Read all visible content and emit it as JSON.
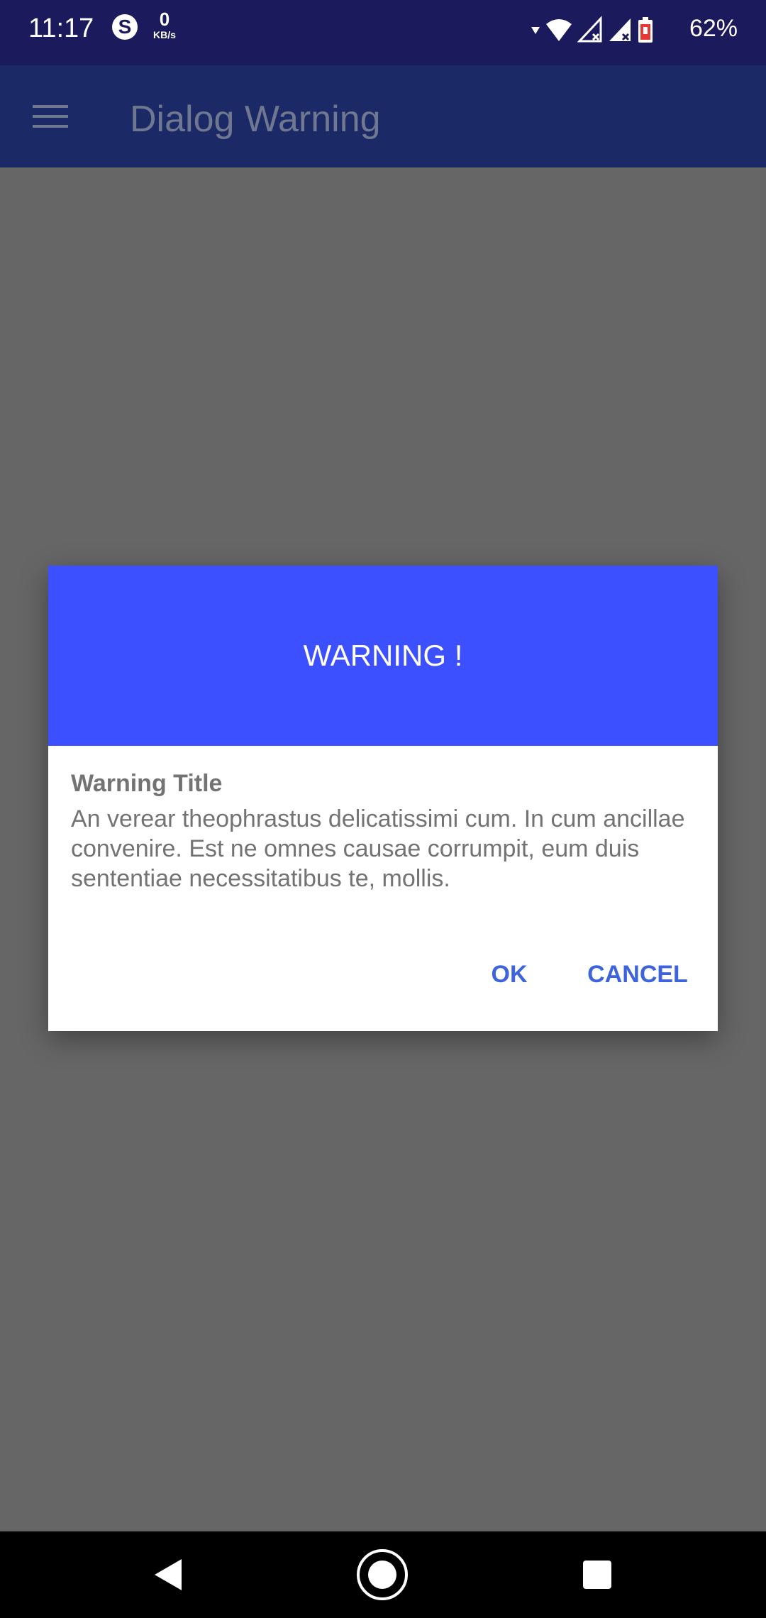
{
  "status_bar": {
    "time": "11:17",
    "net_speed_value": "0",
    "net_speed_unit": "KB/s",
    "battery_percent": "62%",
    "icons": [
      "skype-icon",
      "data-activity-icon",
      "wifi-icon",
      "signal-icon",
      "signal-icon",
      "battery-icon"
    ]
  },
  "app_bar": {
    "title": "Dialog Warning",
    "menu_icon": "menu-icon"
  },
  "dialog": {
    "header": "WARNING !",
    "title": "Warning Title",
    "message": "An verear theophrastus delicatissimi cum. In cum ancillae convenire. Est ne omnes causae corrumpit, eum duis sententiae necessitatibus te, mollis.",
    "ok_label": "OK",
    "cancel_label": "CANCEL"
  },
  "nav_bar": {
    "icons": [
      "back-icon",
      "home-icon",
      "recents-icon"
    ]
  },
  "colors": {
    "status_bar": "#1a1a5c",
    "app_bar": "#1b2a66",
    "dialog_header": "#3d50ff",
    "dialog_button_text": "#3d63dd",
    "scrim": "#666666"
  }
}
